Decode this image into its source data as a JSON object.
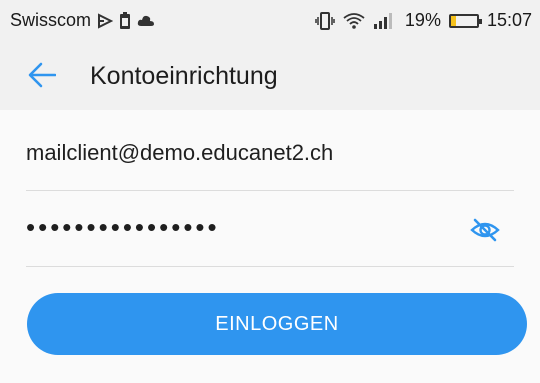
{
  "status_bar": {
    "carrier": "Swisscom",
    "left_icons": [
      "cast-icon",
      "sim-icon",
      "cloud-icon"
    ],
    "right_icons": [
      "vibrate-icon",
      "wifi-icon",
      "signal-icon"
    ],
    "battery_percent_label": "19%",
    "battery_level": 0.19,
    "time": "15:07"
  },
  "app_bar": {
    "title": "Kontoeinrichtung",
    "back_icon": "arrow-left-icon"
  },
  "form": {
    "email_value": "mailclient@demo.educanet2.ch",
    "password_masked": "••••••••••••••••",
    "visibility_icon": "eye-off-icon",
    "login_label": "EINLOGGEN"
  },
  "colors": {
    "accent": "#2f95ef",
    "background": "#f1f1f1",
    "form_background": "#fafafa",
    "battery_fill": "#f6c21c"
  }
}
